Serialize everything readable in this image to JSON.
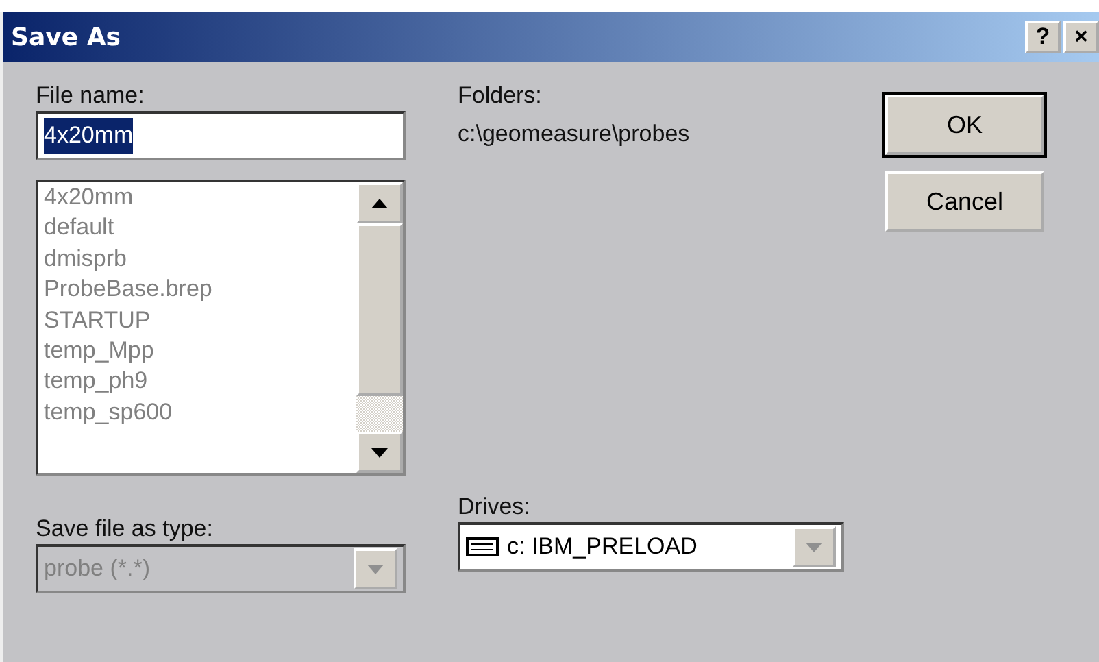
{
  "window": {
    "title": "Save As",
    "title_buttons": [
      "?",
      "×"
    ]
  },
  "file_name": {
    "label": "File name:",
    "value": "4x20mm",
    "text_selected": true
  },
  "files": {
    "disabled": true,
    "items": [
      "4x20mm",
      "default",
      "dmisprb",
      "ProbeBase.brep",
      "STARTUP",
      "temp_Mpp",
      "temp_ph9",
      "temp_sp600"
    ]
  },
  "save_type": {
    "label": "Save file as type:",
    "value": "probe (*.*)",
    "disabled": true
  },
  "folders": {
    "label": "Folders:",
    "path": "c:\\geomeasure\\probes"
  },
  "drives": {
    "label": "Drives:",
    "value": "c: IBM_PRELOAD",
    "disabled": false
  },
  "buttons": [
    {
      "label": "OK",
      "default": true
    },
    {
      "label": "Cancel",
      "default": false
    }
  ]
}
